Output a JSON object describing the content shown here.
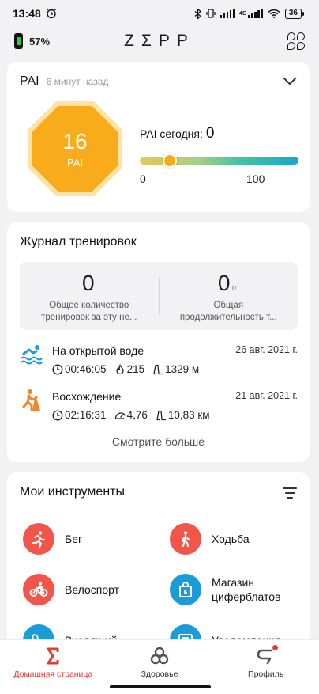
{
  "status_bar": {
    "time": "13:48",
    "network_label": "4G",
    "battery_level": "36"
  },
  "header": {
    "device_battery": "57%",
    "logo": "ZΣPP"
  },
  "pai": {
    "title": "PAI",
    "updated": "6 минут назад",
    "score": "16",
    "score_label": "PAI",
    "today_label": "PAI сегодня:",
    "today_value": "0",
    "scale_min": "0",
    "scale_max": "100",
    "progress_fraction": 0.16,
    "accent_color": "#f8ac1c"
  },
  "journal": {
    "title": "Журнал тренировок",
    "stats": [
      {
        "value": "0",
        "unit": "",
        "label": "Общее количество тренировок за эту не..."
      },
      {
        "value": "0",
        "unit": "m",
        "label": "Общая продолжительность т..."
      }
    ],
    "workouts": [
      {
        "name": "На открытой воде",
        "date": "26 авг. 2021 г.",
        "icon": "open-water-swim-icon",
        "metrics": [
          {
            "icon": "clock-icon",
            "value": "00:46:05"
          },
          {
            "icon": "flame-icon",
            "value": "215"
          },
          {
            "icon": "distance-icon",
            "value": "1329 м"
          }
        ]
      },
      {
        "name": "Восхождение",
        "date": "21 авг. 2021 г.",
        "icon": "climbing-icon",
        "metrics": [
          {
            "icon": "clock-icon",
            "value": "02:16:31"
          },
          {
            "icon": "pace-icon",
            "value": "4,76"
          },
          {
            "icon": "distance-icon",
            "value": "10,83 км"
          }
        ]
      }
    ],
    "more": "Смотрите больше"
  },
  "tools": {
    "title": "Мои инструменты",
    "items": [
      {
        "label": "Бег",
        "icon": "running-icon",
        "color": "#f2564a"
      },
      {
        "label": "Ходьба",
        "icon": "walking-icon",
        "color": "#f2564a"
      },
      {
        "label": "Велоспорт",
        "icon": "cycling-icon",
        "color": "#f2564a"
      },
      {
        "label": "Магазин циферблатов",
        "icon": "watchface-store-icon",
        "color": "#1a9cd8"
      },
      {
        "label": "Входящий",
        "icon": "incoming-call-icon",
        "color": "#1a9cd8"
      },
      {
        "label": "Уведомления",
        "icon": "notification-icon",
        "color": "#1a9cd8"
      }
    ]
  },
  "nav": {
    "home": "Домашняя страница",
    "health": "Здоровье",
    "profile": "Профиль",
    "active_color": "#e8392f"
  }
}
